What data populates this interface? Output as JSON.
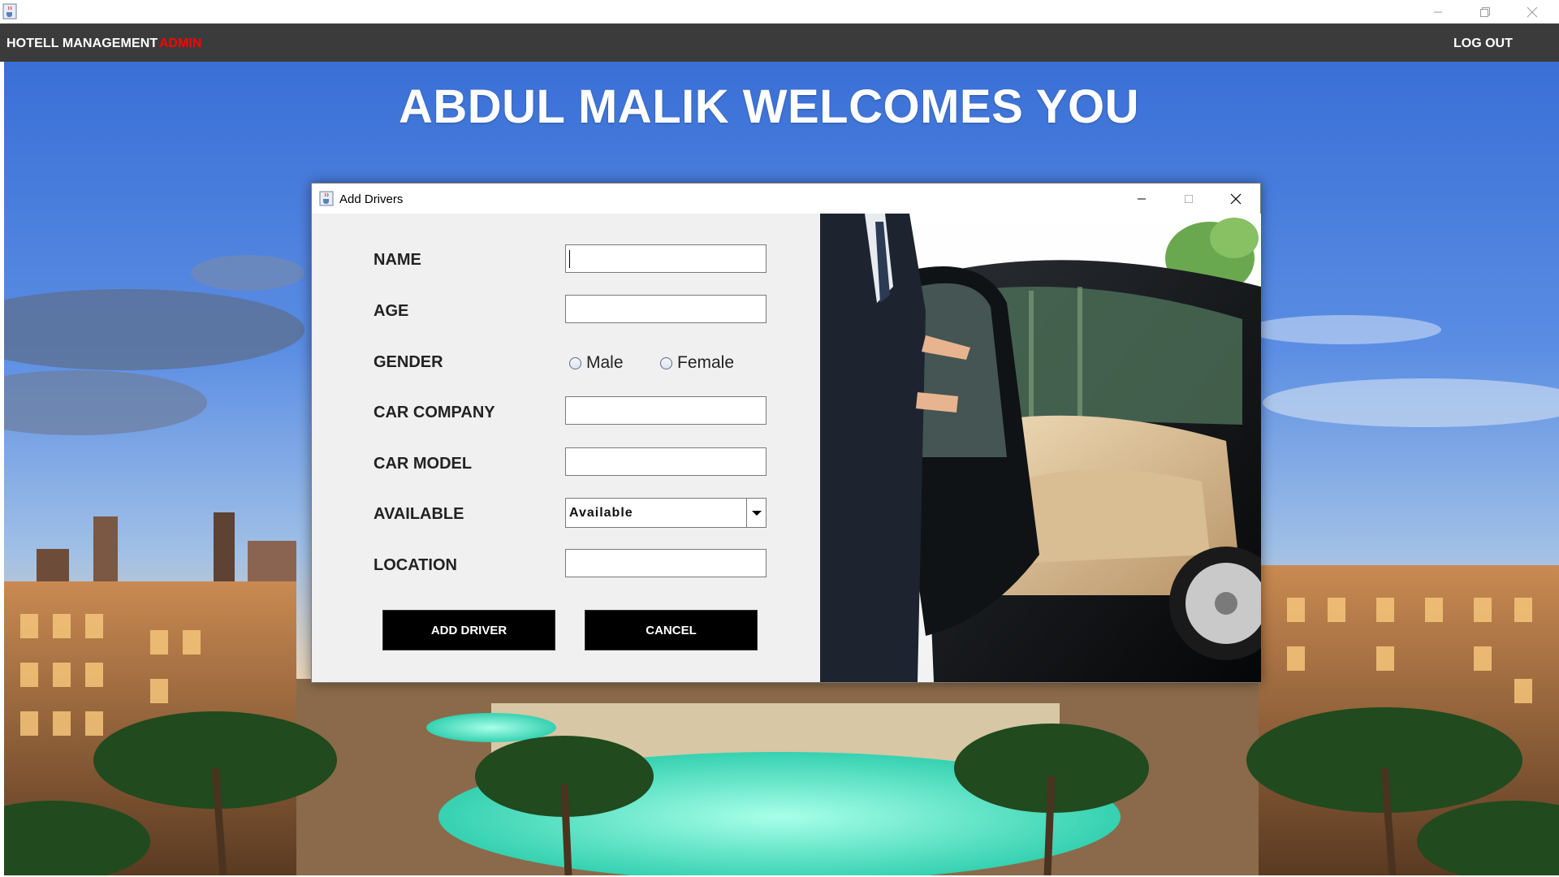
{
  "colors": {
    "menubar": "#3b3b3b",
    "accent_role": "#ff0000",
    "button_bg": "#000000",
    "dialog_bg": "#f0f0f0"
  },
  "outer_window": {
    "icon": "java-cup-icon",
    "controls": [
      "minimize-icon",
      "restore-icon",
      "close-icon"
    ]
  },
  "menubar": {
    "brand": "HOTELL MANAGEMENT",
    "role": "ADMIN",
    "logout": "LOG OUT"
  },
  "background": {
    "heading": "ABDUL MALIK WELCOMES YOU"
  },
  "dialog": {
    "title": "Add Drivers",
    "icon": "java-cup-icon",
    "controls": [
      "minimize-icon",
      "maximize-icon",
      "close-icon"
    ],
    "fields": {
      "name": {
        "label": "NAME",
        "value": ""
      },
      "age": {
        "label": "AGE",
        "value": ""
      },
      "gender": {
        "label": "GENDER",
        "options": [
          "Male",
          "Female"
        ],
        "selected": null
      },
      "car_company": {
        "label": "CAR COMPANY",
        "value": ""
      },
      "car_model": {
        "label": "CAR MODEL",
        "value": ""
      },
      "available": {
        "label": "AVAILABLE",
        "value": "Available"
      },
      "location": {
        "label": "LOCATION",
        "value": ""
      }
    },
    "buttons": {
      "add": "ADD DRIVER",
      "cancel": "CANCEL"
    }
  }
}
